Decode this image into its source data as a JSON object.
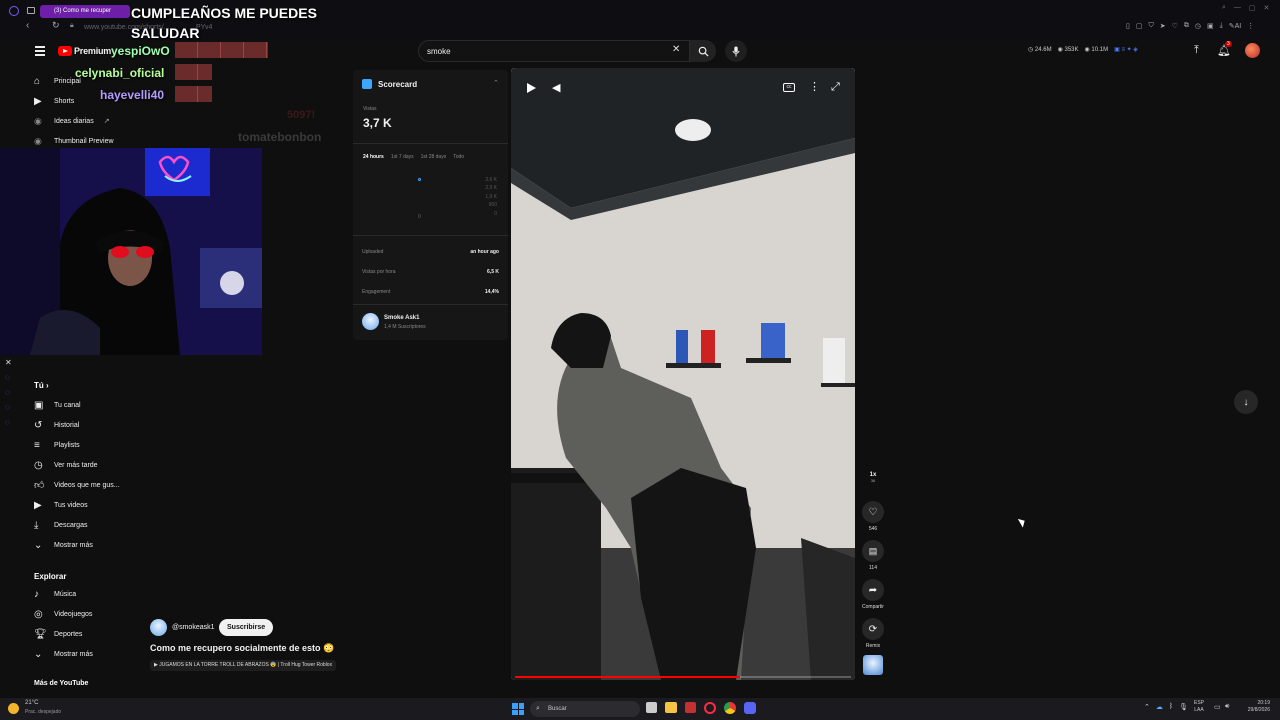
{
  "browser": {
    "tab_title": "(3) Como me recuper",
    "url": "www.youtube.com/shorts/...",
    "url_tail": "PYv4",
    "ext_label": "AI"
  },
  "stream_overlay": {
    "title_line1": "CUMPLEAÑOS ME PUEDES",
    "title_line2": "SALUDAR",
    "chat": [
      {
        "user": "yespiOwO",
        "color": "#9dffb0"
      },
      {
        "user": "celynabi_oficial",
        "color": "#b6ff9a"
      },
      {
        "user": "hayevelli40",
        "color": "#b49cff"
      }
    ],
    "ghost_text_1": "5097!",
    "ghost_text_2": "tomatebonbon"
  },
  "youtube": {
    "logo_text": "Premium",
    "search_value": "smoke",
    "stats": {
      "views": "24.6M",
      "subs": "353K",
      "other": "10.1M"
    },
    "notification_count": "3"
  },
  "sidebar": {
    "top_items": [
      {
        "label": "Principal",
        "icon": "home-icon"
      },
      {
        "label": "Shorts",
        "icon": "shorts-icon"
      },
      {
        "label": "Ideas diarias",
        "icon": "ideas-icon"
      },
      {
        "label": "Thumbnail Preview",
        "icon": "thumbnail-icon"
      }
    ],
    "you_header": "Tú",
    "you_items": [
      {
        "label": "Tu canal",
        "icon": "channel-icon"
      },
      {
        "label": "Historial",
        "icon": "history-icon"
      },
      {
        "label": "Playlists",
        "icon": "playlist-icon"
      },
      {
        "label": "Ver más tarde",
        "icon": "clock-icon"
      },
      {
        "label": "Videos que me gus...",
        "icon": "like-icon"
      },
      {
        "label": "Tus videos",
        "icon": "video-icon"
      },
      {
        "label": "Descargas",
        "icon": "download-icon"
      },
      {
        "label": "Mostrar más",
        "icon": "chevron-down-icon"
      }
    ],
    "explore_header": "Explorar",
    "explore_items": [
      {
        "label": "Música",
        "icon": "music-icon"
      },
      {
        "label": "Videojuegos",
        "icon": "gaming-icon"
      },
      {
        "label": "Deportes",
        "icon": "trophy-icon"
      },
      {
        "label": "Mostrar más",
        "icon": "chevron-down-icon"
      }
    ],
    "more_header": "Más de YouTube"
  },
  "scorecard": {
    "title": "Scorecard",
    "views_label": "Vistas",
    "views_value": "3,7 K",
    "tabs": [
      "24 hours",
      "1st 7 days",
      "1st 28 days",
      "Todo"
    ],
    "y_ticks": [
      "3,6 K",
      "2,9 K",
      "1,9 K",
      "950",
      "0"
    ],
    "x_tick": "0",
    "rows": [
      {
        "label": "Uploaded",
        "value": "an hour ago"
      },
      {
        "label": "Vistas por hora",
        "value": "6,5 K"
      },
      {
        "label": "Engagement",
        "value": "14,4%"
      }
    ],
    "channel_name": "Smoke Ask1",
    "channel_subs": "1,4 M Suscriptores"
  },
  "short": {
    "channel_handle": "@smokeask1",
    "subscribe_label": "Suscribirse",
    "title": "Como me recupero socialmente de esto 😳",
    "related": "▶ JUGAMOS EN LA TORRE TROLL DE ABRAZOS 😨 | Troll Hug Tower Roblox",
    "progress": 0.67,
    "speed": "1x",
    "speed_sub": "36",
    "likes": "546",
    "comments": "114",
    "share_label": "Compartir",
    "remix_label": "Remix"
  },
  "taskbar": {
    "weather_temp": "21°C",
    "weather_desc": "Prac. despejado",
    "search_placeholder": "Buscar",
    "lang": "ESP",
    "lang_sub": "LAA",
    "time": "20:19",
    "date": "29/8/2026"
  },
  "colors": {
    "accent_red": "#ff0000",
    "tab_purple": "#6d1fa8",
    "scorecard_blue": "#3ea6ff"
  }
}
